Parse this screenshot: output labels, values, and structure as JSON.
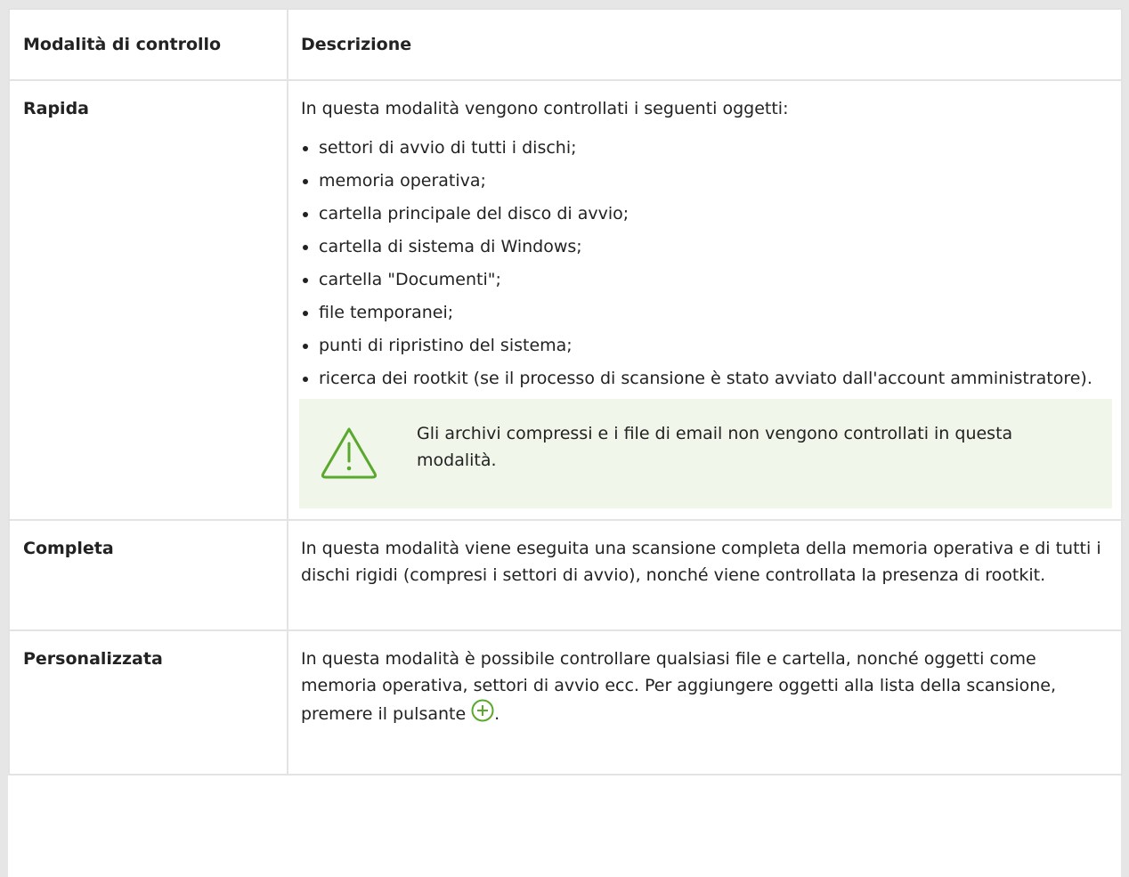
{
  "table": {
    "headers": {
      "mode": "Modalità di controllo",
      "description": "Descrizione"
    },
    "rows": [
      {
        "mode": "Rapida",
        "intro": "In questa modalità vengono controllati i seguenti oggetti:",
        "items": [
          "settori di avvio di tutti i dischi;",
          "memoria operativa;",
          "cartella principale del disco di avvio;",
          "cartella di sistema di Windows;",
          "cartella \"Documenti\";",
          "file temporanei;",
          "punti di ripristino del sistema;",
          "ricerca dei rootkit (se il processo di scansione è stato avviato dall'account amministratore)."
        ],
        "note": {
          "icon": "warning-icon",
          "text": "Gli archivi compressi e i file di email non vengono controllati in questa modalità."
        }
      },
      {
        "mode": "Completa",
        "description": "In questa modalità viene eseguita una scansione completa della memoria operativa e di tutti i dischi rigidi (compresi i settori di avvio), nonché viene controllata la presenza di rootkit."
      },
      {
        "mode": "Personalizzata",
        "description_start": "In questa modalità è possibile controllare qualsiasi file e cartella, nonché oggetti come memoria operativa, settori di avvio ecc. Per aggiungere oggetti alla lista della scansione, premere il pulsante",
        "description_end": ".",
        "button_icon": "add-icon"
      }
    ]
  },
  "colors": {
    "border": "#e3e3e3",
    "note_background": "#f0f6e9",
    "accent_green": "#5aa82e"
  }
}
